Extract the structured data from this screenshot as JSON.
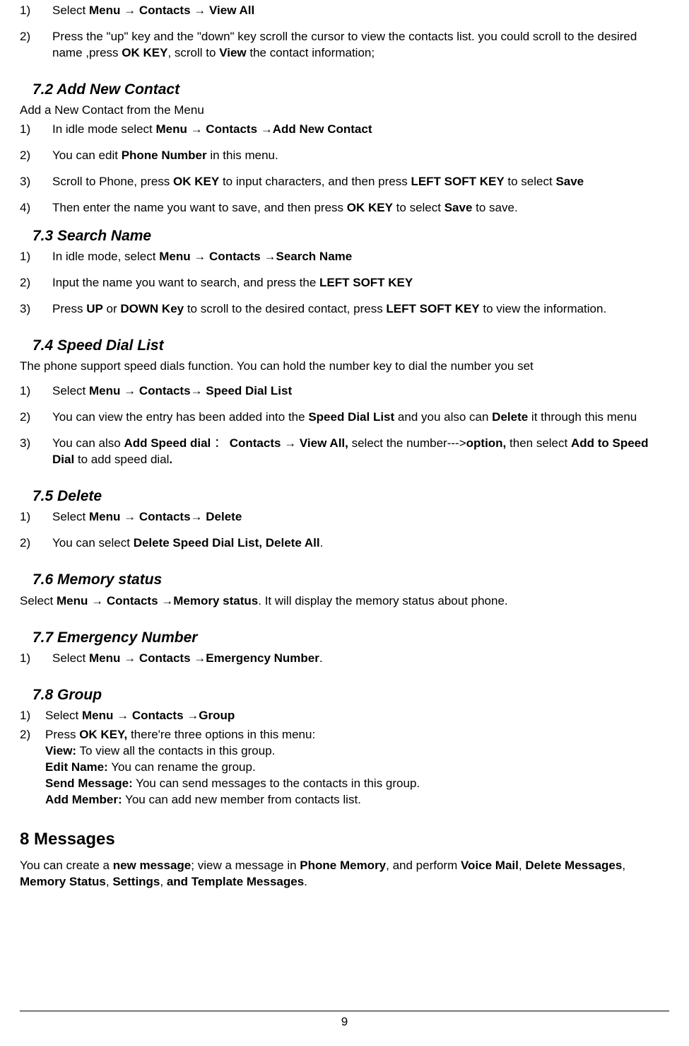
{
  "s71": {
    "li1_a": "Select ",
    "li1_b": "Menu → Contacts → View All",
    "li2_a": "Press the \"up\" key and the \"down\" key scroll the cursor to view the contacts list. you could scroll to the desired name ,press ",
    "li2_b": "OK KEY",
    "li2_c": ", scroll to ",
    "li2_d": "View",
    "li2_e": " the contact information;"
  },
  "s72": {
    "heading": "7.2    Add New Contact",
    "intro": "Add a New Contact from the Menu",
    "li1_a": "In idle mode select ",
    "li1_b": "Menu → Contacts →Add  New Contact",
    "li2_a": "You can edit ",
    "li2_b": "Phone Number",
    "li2_c": " in this menu.",
    "li3_a": "Scroll to Phone, press ",
    "li3_b": "OK KEY",
    "li3_c": " to input characters, and then press ",
    "li3_d": "LEFT SOFT KEY",
    "li3_e": "  to select ",
    "li3_f": "Save",
    "li4_a": "Then enter the name you want to save, and then press ",
    "li4_b": "OK KEY",
    "li4_c": " to select ",
    "li4_d": "Save",
    "li4_e": " to save."
  },
  "s73": {
    "heading": "7.3    Search Name",
    "li1_a": "In idle mode, select ",
    "li1_b": "Menu → Contacts →Search Name",
    "li2_a": "Input the name you want to search, and press the ",
    "li2_b": "LEFT SOFT KEY",
    "li3_a": "Press ",
    "li3_b": "UP",
    "li3_c": " or ",
    "li3_d": "DOWN Key",
    "li3_e": " to scroll to the desired contact, press ",
    "li3_f": "LEFT SOFT KEY",
    "li3_g": " to view the information."
  },
  "s74": {
    "heading": "7.4    Speed Dial List",
    "intro": "The phone support speed dials function. You can hold the number key to dial the number you set",
    "li1_a": "Select ",
    "li1_b": "Menu → Contacts→ Speed Dial List",
    "li2_a": "You can view the entry has been added into the ",
    "li2_b": "Speed Dial List",
    "li2_c": " and you also can ",
    "li2_d": "Delete",
    "li2_e": " it through this menu",
    "li3_a": "You can also ",
    "li3_b": "Add Speed dial ",
    "li3_c": "：  ",
    "li3_d": "Contacts → View All, ",
    "li3_e": "select the number--->",
    "li3_f": "option, ",
    "li3_g": "then select ",
    "li3_h": "Add to Speed Dial",
    "li3_i": " to add speed dial",
    "li3_j": "."
  },
  "s75": {
    "heading": "7.5    Delete",
    "li1_a": "Select ",
    "li1_b": "Menu → Contacts→ Delete",
    "li2_a": "You can select ",
    "li2_b": "Delete Speed Dial List, Delete All",
    "li2_c": "."
  },
  "s76": {
    "heading": "7.6    Memory status",
    "p_a": "Select ",
    "p_b": "Menu → Contacts →Memory status",
    "p_c": ". It will display the memory status about phone."
  },
  "s77": {
    "heading": "7.7    Emergency Number",
    "li1_a": "Select ",
    "li1_b": "Menu → Contacts →Emergency Number",
    "li1_c": "."
  },
  "s78": {
    "heading": "7.8    Group",
    "li1_a": "Select ",
    "li1_b": "Menu → Contacts →Group",
    "li2_a": "Press ",
    "li2_b": "OK KEY, ",
    "li2_c": "there're three options in this menu:",
    "li2_v_a": "View:",
    "li2_v_b": " To view all the contacts in this group.",
    "li2_e_a": "Edit Name:",
    "li2_e_b": " You can rename the group.",
    "li2_s_a": "Send Message:",
    "li2_s_b": " You can send messages to the contacts in this group.",
    "li2_m_a": "Add Member:",
    "li2_m_b": " You can add new member from contacts list."
  },
  "s8": {
    "heading": "8    Messages",
    "p_a": "You can create a ",
    "p_b": "new message",
    "p_c": "; view a message in ",
    "p_d": "Phone Memory",
    "p_e": ", and perform ",
    "p_f": "Voice Mail",
    "p_g": ", ",
    "p_h": "Delete Messages",
    "p_i": ", ",
    "p_j": "Memory Status",
    "p_k": ", ",
    "p_l": "Settings",
    "p_m": ", ",
    "p_n": "and Template Messages",
    "p_o": "."
  },
  "page_number": "9"
}
